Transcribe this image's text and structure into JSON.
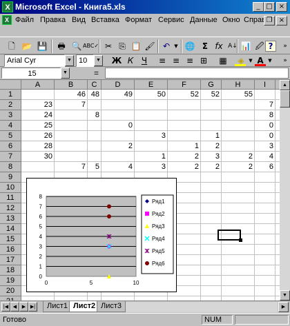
{
  "window": {
    "title": "Microsoft Excel - Книга5.xls"
  },
  "menu": [
    "Файл",
    "Правка",
    "Вид",
    "Вставка",
    "Формат",
    "Сервис",
    "Данные",
    "Окно",
    "Справка"
  ],
  "toolbar": {
    "font_name": "Arial Cyr",
    "font_size": "10"
  },
  "formula_bar": {
    "name_box": "15",
    "equals": "="
  },
  "columns": [
    "A",
    "B",
    "C",
    "D",
    "E",
    "F",
    "G",
    "H",
    "I",
    "J"
  ],
  "rows": [
    "1",
    "2",
    "3",
    "4",
    "5",
    "6",
    "7",
    "8",
    "9",
    "10",
    "11",
    "12",
    "13",
    "14",
    "15",
    "16",
    "17",
    "18",
    "19",
    "20",
    "21"
  ],
  "cells": [
    {
      "r": 0,
      "c": 1,
      "v": "46"
    },
    {
      "r": 0,
      "c": 2,
      "v": "48"
    },
    {
      "r": 0,
      "c": 3,
      "v": "49"
    },
    {
      "r": 0,
      "c": 4,
      "v": "50"
    },
    {
      "r": 0,
      "c": 5,
      "v": "52"
    },
    {
      "r": 0,
      "c": 6,
      "v": "52"
    },
    {
      "r": 0,
      "c": 7,
      "v": "55"
    },
    {
      "r": 1,
      "c": 0,
      "v": "23"
    },
    {
      "r": 1,
      "c": 1,
      "v": "7"
    },
    {
      "r": 1,
      "c": 8,
      "v": "7"
    },
    {
      "r": 2,
      "c": 0,
      "v": "24"
    },
    {
      "r": 2,
      "c": 2,
      "v": "8"
    },
    {
      "r": 2,
      "c": 8,
      "v": "8"
    },
    {
      "r": 3,
      "c": 0,
      "v": "25"
    },
    {
      "r": 3,
      "c": 3,
      "v": "0"
    },
    {
      "r": 3,
      "c": 8,
      "v": "0"
    },
    {
      "r": 4,
      "c": 0,
      "v": "26"
    },
    {
      "r": 4,
      "c": 4,
      "v": "3"
    },
    {
      "r": 4,
      "c": 6,
      "v": "1"
    },
    {
      "r": 4,
      "c": 8,
      "v": "0"
    },
    {
      "r": 5,
      "c": 0,
      "v": "28"
    },
    {
      "r": 5,
      "c": 3,
      "v": "2"
    },
    {
      "r": 5,
      "c": 5,
      "v": "1"
    },
    {
      "r": 5,
      "c": 6,
      "v": "2"
    },
    {
      "r": 5,
      "c": 8,
      "v": "3"
    },
    {
      "r": 6,
      "c": 0,
      "v": "30"
    },
    {
      "r": 6,
      "c": 4,
      "v": "1"
    },
    {
      "r": 6,
      "c": 5,
      "v": "2"
    },
    {
      "r": 6,
      "c": 6,
      "v": "3"
    },
    {
      "r": 6,
      "c": 7,
      "v": "2"
    },
    {
      "r": 6,
      "c": 8,
      "v": "4"
    },
    {
      "r": 7,
      "c": 1,
      "v": "7"
    },
    {
      "r": 7,
      "c": 2,
      "v": "5"
    },
    {
      "r": 7,
      "c": 3,
      "v": "4"
    },
    {
      "r": 7,
      "c": 4,
      "v": "3"
    },
    {
      "r": 7,
      "c": 5,
      "v": "2"
    },
    {
      "r": 7,
      "c": 6,
      "v": "2"
    },
    {
      "r": 7,
      "c": 7,
      "v": "2"
    },
    {
      "r": 7,
      "c": 8,
      "v": "6"
    }
  ],
  "chart_data": {
    "type": "scatter",
    "xlim": [
      0,
      10
    ],
    "ylim": [
      0,
      8
    ],
    "x_ticks": [
      "0",
      "5",
      "10"
    ],
    "y_ticks": [
      "0",
      "1",
      "2",
      "3",
      "4",
      "5",
      "6",
      "7",
      "8"
    ],
    "grid": true,
    "legend_placement": "right",
    "series": [
      {
        "name": "Ряд1",
        "color": "#000080",
        "marker": "diamond",
        "points": []
      },
      {
        "name": "Ряд2",
        "color": "#ff00ff",
        "marker": "square",
        "points": [
          [
            7,
            3
          ]
        ]
      },
      {
        "name": "Ряд3",
        "color": "#ffff00",
        "marker": "triangle",
        "points": [
          [
            7,
            0
          ]
        ]
      },
      {
        "name": "Ряд4",
        "color": "#00ffff",
        "marker": "x",
        "points": [
          [
            7,
            3
          ]
        ]
      },
      {
        "name": "Ряд5",
        "color": "#800080",
        "marker": "star",
        "points": [
          [
            7,
            4
          ]
        ]
      },
      {
        "name": "Ряд6",
        "color": "#800000",
        "marker": "circle",
        "points": [
          [
            7,
            7
          ],
          [
            7,
            6
          ]
        ]
      }
    ]
  },
  "sheet_tabs": [
    "Лист1",
    "Лист2",
    "Лист3"
  ],
  "active_tab": "Лист2",
  "status": {
    "left": "Готово",
    "num": "NUM"
  }
}
